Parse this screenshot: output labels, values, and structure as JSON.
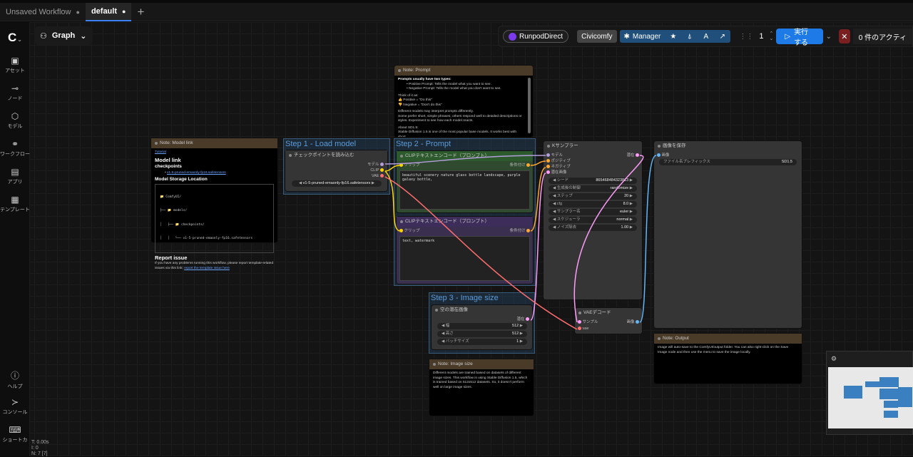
{
  "tabs": [
    {
      "label": "Unsaved Workflow",
      "active": false
    },
    {
      "label": "default",
      "active": true
    }
  ],
  "tab_modified_dot": "●",
  "add_tab": "+",
  "graph_label": "Graph",
  "sidebar": [
    {
      "label": "アセット",
      "icon": "image-icon"
    },
    {
      "label": "ノード",
      "icon": "node-icon"
    },
    {
      "label": "モデル",
      "icon": "model-icon"
    },
    {
      "label": "ワークフロー",
      "icon": "workflow-icon"
    },
    {
      "label": "アプリ",
      "icon": "app-icon"
    },
    {
      "label": "テンプレート",
      "icon": "template-icon"
    },
    {
      "label": "ヘルプ",
      "icon": "help-icon"
    },
    {
      "label": "コンソール",
      "icon": "console-icon"
    },
    {
      "label": "ショートカ",
      "icon": "keyboard-icon"
    }
  ],
  "toolbar": {
    "runpod": "RunpodDirect",
    "civitai": "Civicomfy",
    "manager": "Manager",
    "queue_count": "1",
    "run": "実行する",
    "active_queue": "0 件のアクティ"
  },
  "stats": {
    "time": "T: 0.00s",
    "i": "I: 0",
    "n": "N: 7 [7]"
  },
  "groups": {
    "load": "Step 1 - Load model",
    "prompt": "Step 2 - Prompt",
    "size": "Step 3 - Image size"
  },
  "notes": {
    "model_link": {
      "title": "Note: Model link",
      "tutorial": "Tutorial",
      "h_model_link": "Model link",
      "h_checkpoints": "checkpoints",
      "ckpt_link": "v1-5-pruned-emaonly-fp16.safetensors",
      "storage": "Model Storage Location",
      "tree": [
        "📁 ComfyUI/",
        "├── 📁 models/",
        "│   ├── 📁 checkpoints/",
        "│   │   └── v1-5-pruned-emaonly-fp16.safetensors"
      ],
      "h_report": "Report issue",
      "report_text": "If you have any problems running this workflow, please report template-related issues via this link:",
      "report_link": "report the template issue here"
    },
    "prompt": {
      "title": "Note: Prompt",
      "intro": "Prompts usually have two types:",
      "pos": "Positive Prompt: Tells the model what you want to see.",
      "neg": "Negative Prompt: Tells the model what you don't want to see.",
      "think": "Think of it as:",
      "pos_short": "👍 Positive = \"Do this\"",
      "neg_short": "👎 Negative = \"Don't do this\"",
      "diff": "Different models may interpret prompts differently.",
      "diff2": "Some prefer short, simple phrases; others respond well to detailed descriptions or styles. Experiment to see how each model reacts.",
      "about": "About SD1.5:",
      "about2": "Stable Diffusion 1.5 is one of the most popular base models. It works best with short,"
    },
    "size": {
      "title": "Note: Image size",
      "text": "Different models are trained based on datasets of different image sizes. This workflow is using Stable Diffusion 1.5, which is trained based on 512x512 datasets. So, it doesn't perform well on large image sizes."
    },
    "output": {
      "title": "Note: Output",
      "text": "Image will auto-save to the ComfyUI/output folder. You can also right-click on the Save Image node and then use the menu to save the image locally."
    }
  },
  "nodes": {
    "ckpt": {
      "title": "チェックポイントを読み込む",
      "out_model": "モデル",
      "out_clip": "CLIP",
      "out_vae": "VAE",
      "ckpt_name": "v1-5-pruned-emaonly-fp16.safetensors"
    },
    "clip_pos": {
      "title": "CLIPテキストエンコード（プロンプト）",
      "in": "クリップ",
      "out": "条件付け",
      "text": "beautiful scenery nature glass bottle landscape, purple galaxy bottle,"
    },
    "clip_neg": {
      "title": "CLIPテキストエンコード（プロンプト）",
      "in": "クリップ",
      "out": "条件付け",
      "text": "text, watermark"
    },
    "latent": {
      "title": "空の潜在画像",
      "out": "潜在",
      "widgets": [
        {
          "label": "幅",
          "value": "512"
        },
        {
          "label": "高さ",
          "value": "512"
        },
        {
          "label": "バッチサイズ",
          "value": "1"
        }
      ]
    },
    "ksampler": {
      "title": "Kサンプラー",
      "inputs": [
        "モデル",
        "ポジティブ",
        "ネガティブ",
        "潜在画像"
      ],
      "out": "潜在",
      "widgets": [
        {
          "label": "シード",
          "value": "865468484323813"
        },
        {
          "label": "生成後の制御",
          "value": "randomize"
        },
        {
          "label": "ステップ",
          "value": "20"
        },
        {
          "label": "cfg",
          "value": "8.0"
        },
        {
          "label": "サンプラー名",
          "value": "euler"
        },
        {
          "label": "スケジューラ",
          "value": "normal"
        },
        {
          "label": "ノイズ除去",
          "value": "1.00"
        }
      ]
    },
    "vae": {
      "title": "VAEデコード",
      "in_samples": "サンプル",
      "in_vae": "vae",
      "out": "画像"
    },
    "save": {
      "title": "画像を保存",
      "in": "画像",
      "prefix_label": "ファイル名プレフィックス",
      "prefix_value": "SD1.5"
    }
  },
  "colors": {
    "accent": "#1e7ae6",
    "model": "#b39ddb",
    "clip": "#ffd500",
    "vae": "#ff6e6e",
    "cond": "#ffa931",
    "latent": "#ff9cf9",
    "image": "#64b5f6"
  }
}
